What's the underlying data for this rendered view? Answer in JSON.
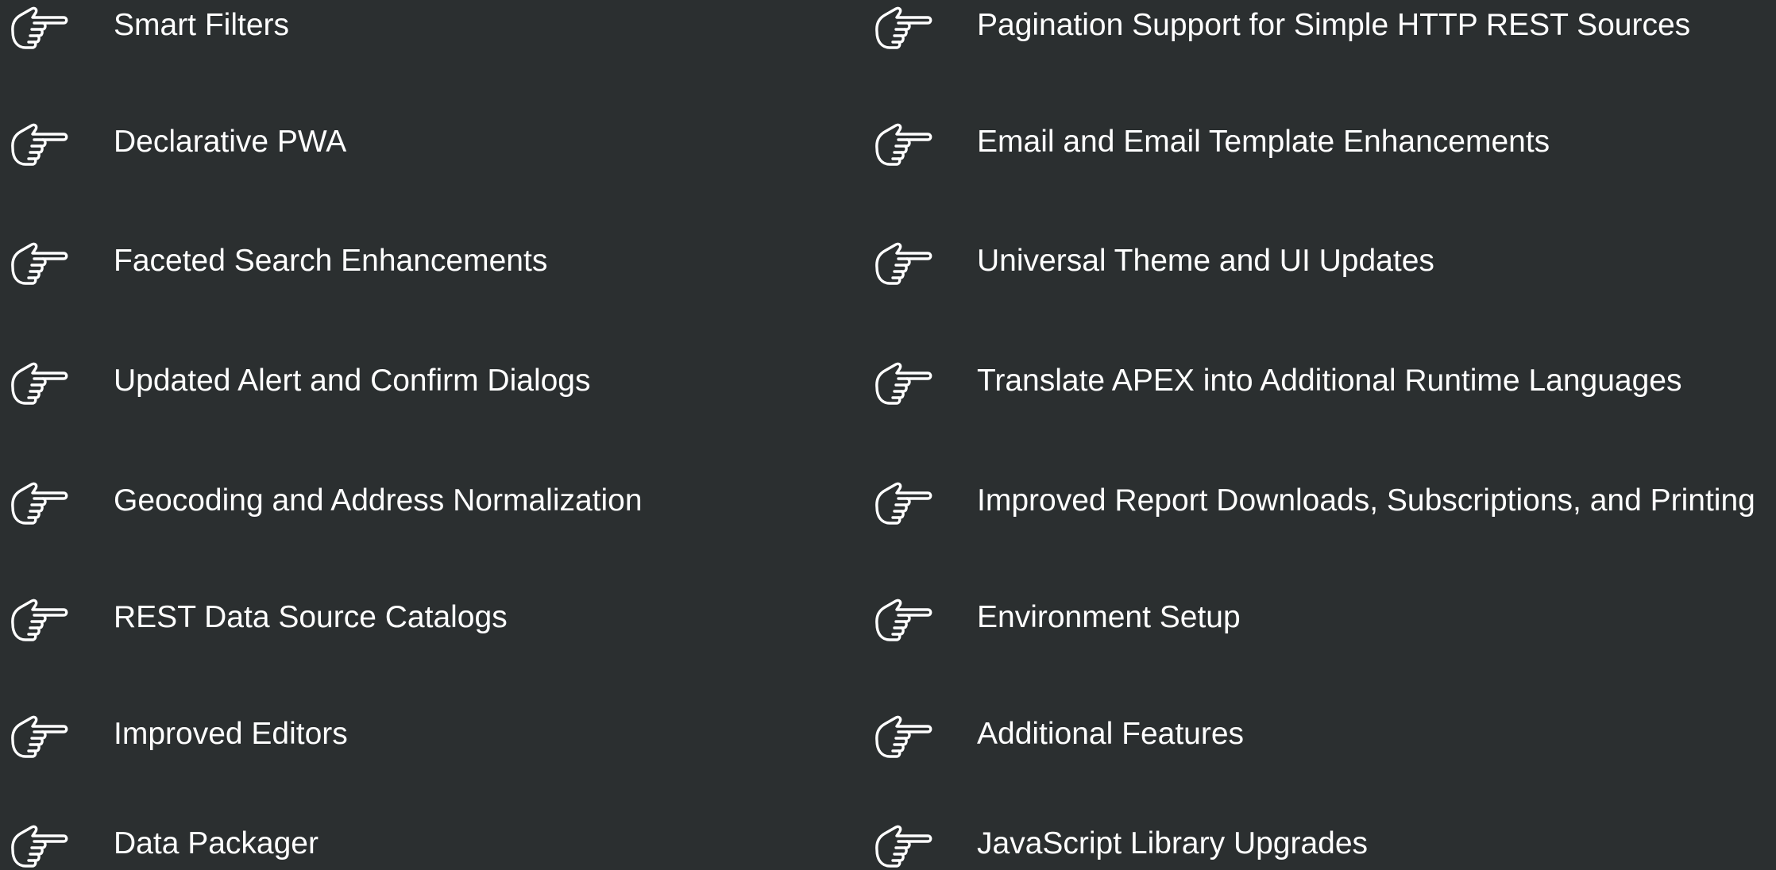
{
  "slide": {
    "background_color": "#2b2f30",
    "text_color": "#ffffff",
    "bullet_icon": "pointing-hand-icon",
    "left_items": [
      "Smart Filters",
      "Declarative PWA",
      "Faceted Search Enhancements",
      "Updated Alert and Confirm Dialogs",
      "Geocoding and Address Normalization",
      "REST Data Source Catalogs",
      "Improved Editors",
      "Data Packager"
    ],
    "right_items": [
      "Pagination Support for Simple HTTP REST Sources",
      "Email and Email Template Enhancements",
      "Universal Theme and UI Updates",
      "Translate APEX into Additional Runtime Languages",
      "Improved Report Downloads, Subscriptions, and Printing",
      "Environment Setup",
      "Additional Features",
      "JavaScript Library Upgrades"
    ]
  }
}
